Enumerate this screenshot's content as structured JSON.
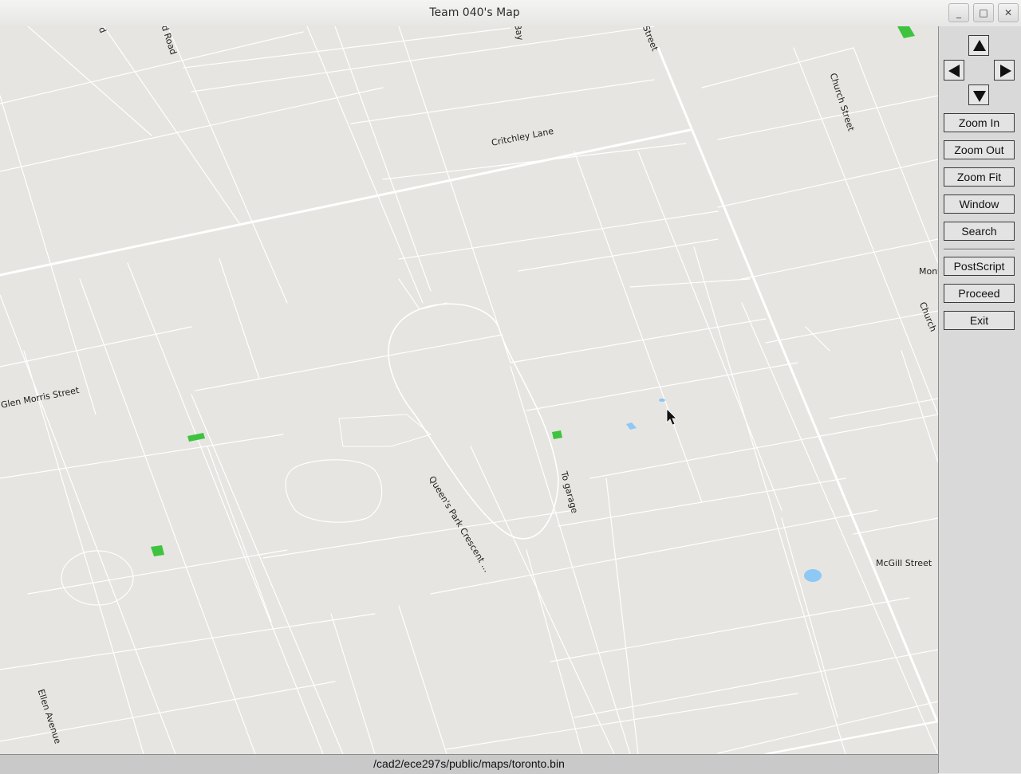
{
  "window": {
    "title": "Team 040's Map",
    "minimize_glyph": "_",
    "maximize_glyph": "□",
    "close_glyph": "✕"
  },
  "map": {
    "labels": [
      {
        "id": "street-d",
        "text": "d"
      },
      {
        "id": "d-road",
        "text": "d Road"
      },
      {
        "id": "bay",
        "text": "Bay"
      },
      {
        "id": "street-top",
        "text": "Street"
      },
      {
        "id": "church-street-top",
        "text": "Church Street"
      },
      {
        "id": "critchley-lane",
        "text": "Critchley Lane"
      },
      {
        "id": "mont",
        "text": "Mont"
      },
      {
        "id": "church-right",
        "text": "Church"
      },
      {
        "id": "glen-morris-street",
        "text": "Glen Morris Street"
      },
      {
        "id": "queens-park-crescent",
        "text": "Queen's Park Crescent ..."
      },
      {
        "id": "to-garage",
        "text": "To garage"
      },
      {
        "id": "mcgill-street",
        "text": "McGill Street"
      },
      {
        "id": "ellen-avenue",
        "text": "Ellen Avenue"
      }
    ],
    "colors": {
      "background": "#e6e5e1",
      "street": "#ffffff",
      "park": "#3ec33e",
      "water": "#8ec8f4"
    }
  },
  "panel": {
    "arrows": {
      "up": "pan-up",
      "down": "pan-down",
      "left": "pan-left",
      "right": "pan-right"
    },
    "buttons": {
      "zoom_in": "Zoom In",
      "zoom_out": "Zoom Out",
      "zoom_fit": "Zoom Fit",
      "window": "Window",
      "search": "Search",
      "postscript": "PostScript",
      "proceed": "Proceed",
      "exit": "Exit"
    }
  },
  "status": {
    "text": "/cad2/ece297s/public/maps/toronto.bin"
  }
}
